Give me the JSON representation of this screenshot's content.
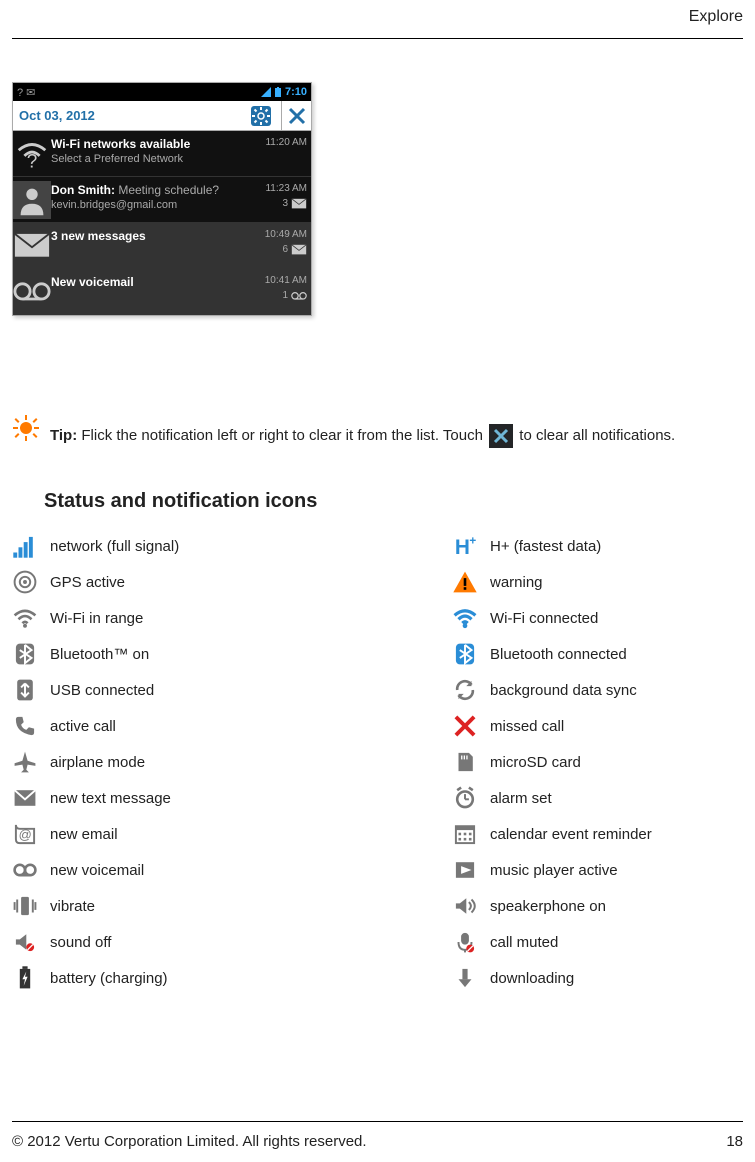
{
  "header": {
    "title": "Explore"
  },
  "phone": {
    "status_left": "?  ✉",
    "status_right_time": "7:10",
    "date": "Oct 03, 2012",
    "notifications": [
      {
        "title": "Wi-Fi networks available",
        "sub": "Select a Preferred Network",
        "time": "11:20 AM",
        "count": "",
        "style": "dark",
        "icon": "wifi-question-icon"
      },
      {
        "title": "Don Smith:",
        "title_extra": "Meeting schedule?",
        "sub": "kevin.bridges@gmail.com",
        "time": "11:23 AM",
        "count": "3",
        "count_icon": "mail-icon",
        "style": "dark",
        "icon": "avatar-icon"
      },
      {
        "title": "3 new messages",
        "sub": "",
        "time": "10:49 AM",
        "count": "6",
        "count_icon": "mail-icon",
        "style": "light",
        "icon": "mail-icon"
      },
      {
        "title": "New voicemail",
        "sub": "",
        "time": "10:41 AM",
        "count": "1",
        "count_icon": "voicemail-icon",
        "style": "light",
        "icon": "voicemail-icon"
      }
    ]
  },
  "tip": {
    "label_bold": "Tip:",
    "text_part1": " Flick the notification left or right to clear it from the list. Touch ",
    "text_part2": " to clear all notifications."
  },
  "section_heading": "Status and notification icons",
  "icons": {
    "left": [
      {
        "name": "network-signal-icon",
        "label": "network (full signal)"
      },
      {
        "name": "gps-active-icon",
        "label": "GPS active"
      },
      {
        "name": "wifi-range-icon",
        "label": "Wi-Fi in range"
      },
      {
        "name": "bluetooth-on-icon",
        "label": "Bluetooth™ on"
      },
      {
        "name": "usb-connected-icon",
        "label": "USB connected"
      },
      {
        "name": "active-call-icon",
        "label": "active call"
      },
      {
        "name": "airplane-mode-icon",
        "label": "airplane mode"
      },
      {
        "name": "new-text-message-icon",
        "label": "new text message"
      },
      {
        "name": "new-email-icon",
        "label": "new email"
      },
      {
        "name": "new-voicemail-icon",
        "label": "new voicemail"
      },
      {
        "name": "vibrate-icon",
        "label": "vibrate"
      },
      {
        "name": "sound-off-icon",
        "label": "sound off"
      },
      {
        "name": "battery-charging-icon",
        "label": "battery (charging)"
      }
    ],
    "right": [
      {
        "name": "h-plus-icon",
        "label": "H+ (fastest data)"
      },
      {
        "name": "warning-icon",
        "label": "warning"
      },
      {
        "name": "wifi-connected-icon",
        "label": "Wi-Fi connected"
      },
      {
        "name": "bluetooth-connected-icon",
        "label": "Bluetooth connected"
      },
      {
        "name": "background-sync-icon",
        "label": "background data sync"
      },
      {
        "name": "missed-call-icon",
        "label": "missed call"
      },
      {
        "name": "microsd-card-icon",
        "label": "microSD card"
      },
      {
        "name": "alarm-set-icon",
        "label": "alarm set"
      },
      {
        "name": "calendar-reminder-icon",
        "label": "calendar event reminder"
      },
      {
        "name": "music-player-icon",
        "label": "music player active"
      },
      {
        "name": "speakerphone-on-icon",
        "label": "speakerphone on"
      },
      {
        "name": "call-muted-icon",
        "label": "call muted"
      },
      {
        "name": "downloading-icon",
        "label": "downloading"
      }
    ]
  },
  "footer": {
    "copyright": "© 2012 Vertu Corporation Limited. All rights reserved.",
    "page": "18"
  }
}
